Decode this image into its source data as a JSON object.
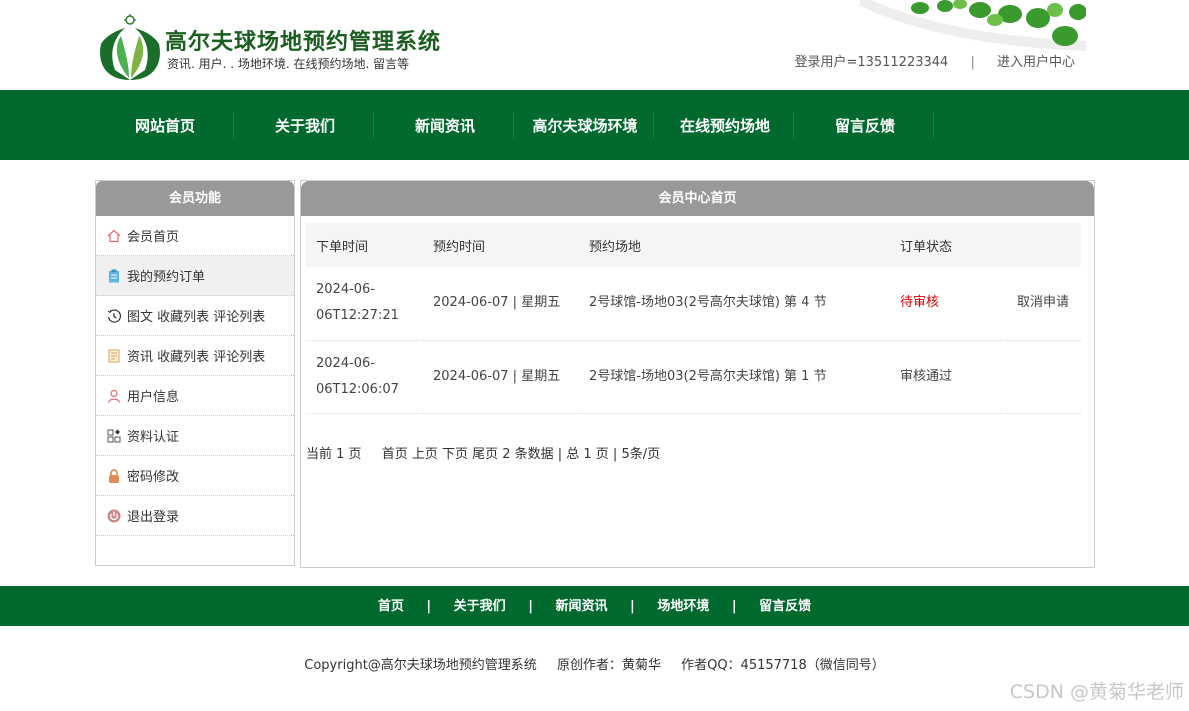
{
  "header": {
    "site_title": "高尔夫球场地预约管理系统",
    "site_subtitle": "资讯. 用户. . 场地环境. 在线预约场地. 留言等",
    "user_label": "登录用户=13511223344",
    "separator": "|",
    "user_center": "进入用户中心"
  },
  "nav": [
    {
      "label": "网站首页"
    },
    {
      "label": "关于我们"
    },
    {
      "label": "新闻资讯"
    },
    {
      "label": "高尔夫球场环境"
    },
    {
      "label": "在线预约场地"
    },
    {
      "label": "留言反馈"
    }
  ],
  "sidebar": {
    "title": "会员功能",
    "items": [
      {
        "label": "会员首页",
        "icon": "home-icon"
      },
      {
        "label": "我的预约订单",
        "icon": "clipboard-icon"
      },
      {
        "label": "图文 收藏列表 评论列表",
        "icon": "history-icon"
      },
      {
        "label": "资讯 收藏列表 评论列表",
        "icon": "document-icon"
      },
      {
        "label": "用户信息",
        "icon": "user-icon"
      },
      {
        "label": "资料认证",
        "icon": "grid-icon"
      },
      {
        "label": "密码修改",
        "icon": "lock-icon"
      },
      {
        "label": "退出登录",
        "icon": "power-icon"
      }
    ]
  },
  "main": {
    "title": "会员中心首页",
    "columns": [
      "下单时间",
      "预约时间",
      "预约场地",
      "订单状态",
      ""
    ],
    "rows": [
      {
        "order_time_1": "2024-06-",
        "order_time_2": "06T12:27:21",
        "book_time": "2024-06-07 | 星期五",
        "venue": "2号球馆-场地03(2号高尔夫球馆) 第 4 节",
        "status": "待审核",
        "action": "取消申请"
      },
      {
        "order_time_1": "2024-06-",
        "order_time_2": "06T12:06:07",
        "book_time": "2024-06-07 | 星期五",
        "venue": "2号球馆-场地03(2号高尔夫球馆) 第 1 节",
        "status": "审核通过",
        "action": ""
      }
    ],
    "pager": {
      "current": "当前 1 页",
      "links": "首页 上页 下页 尾页 2 条数据 | 总 1 页 | 5条/页"
    }
  },
  "footer": {
    "links": [
      "首页",
      "关于我们",
      "新闻资讯",
      "场地环境",
      "留言反馈"
    ],
    "separator": "|",
    "copyright": "Copyright@高尔夫球场地预约管理系统",
    "author": "原创作者：黄菊华",
    "qq": "作者QQ：45157718（微信同号）"
  },
  "watermark": "CSDN @黄菊华老师",
  "colors": {
    "nav_green": "#006a2e",
    "panel_head": "#999999",
    "pending_red": "#dd0000"
  }
}
